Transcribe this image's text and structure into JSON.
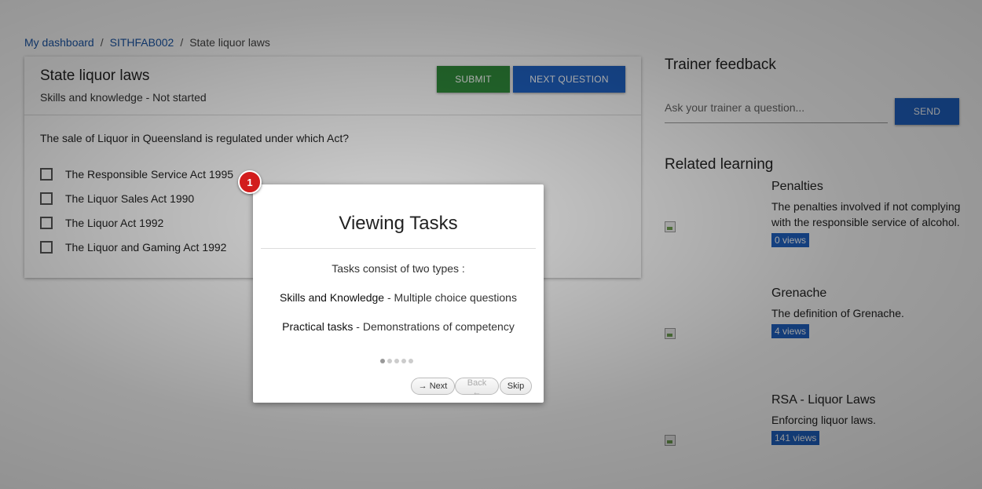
{
  "breadcrumb": {
    "items": [
      "My dashboard",
      "SITHFAB002"
    ],
    "current": "State liquor laws",
    "separator": "/"
  },
  "task": {
    "title": "State liquor laws",
    "subtitle": "Skills and knowledge - Not started",
    "submit_label": "SUBMIT",
    "next_label": "NEXT QUESTION",
    "question": "The sale of Liquor in Queensland is regulated under which Act?",
    "options": [
      "The Responsible Service Act 1995",
      "The Liquor Sales Act 1990",
      "The Liquor Act 1992",
      "The Liquor and Gaming Act 1992"
    ]
  },
  "feedback": {
    "title": "Trainer feedback",
    "placeholder": "Ask your trainer a question...",
    "send_label": "SEND"
  },
  "related": {
    "title": "Related learning",
    "items": [
      {
        "name": "Penalties",
        "description": "The penalties involved if not complying with the responsible service of alcohol.",
        "views": "0 views"
      },
      {
        "name": "Grenache",
        "description": "The definition of Grenache.",
        "views": "4 views"
      },
      {
        "name": "RSA - Liquor Laws",
        "description": "Enforcing liquor laws.",
        "views": "141 views"
      }
    ]
  },
  "tour": {
    "step_number": "1",
    "title": "Viewing Tasks",
    "intro": "Tasks consist of two types :",
    "line1_bold": "Skills and Knowledge",
    "line1_rest": " - Multiple choice questions",
    "line2_bold": "Practical tasks",
    "line2_rest": " - Demonstrations of competency",
    "total_steps": 5,
    "current_step": 1,
    "next_label": "→ Next",
    "back_label": "Back ←",
    "skip_label": "Skip"
  },
  "colors": {
    "primary": "#1f62c4",
    "success": "#2f8a3a",
    "badge": "#d21c1c",
    "link": "#1a56a8"
  }
}
